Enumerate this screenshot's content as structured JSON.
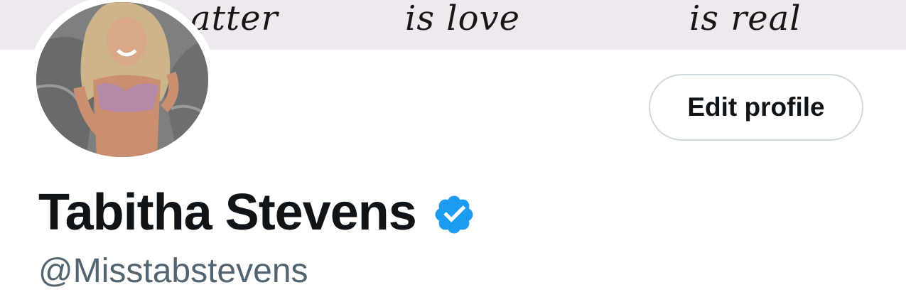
{
  "banner": {
    "words": [
      "atter",
      "is love",
      "is real"
    ],
    "background_color": "#ede9ee"
  },
  "profile": {
    "avatar_icon": "profile-photo",
    "display_name": "Tabitha Stevens",
    "verified_icon": "verified-badge-icon",
    "verified_color": "#1d9bf0",
    "handle": "@Misstabstevens"
  },
  "actions": {
    "edit_profile_label": "Edit profile"
  }
}
